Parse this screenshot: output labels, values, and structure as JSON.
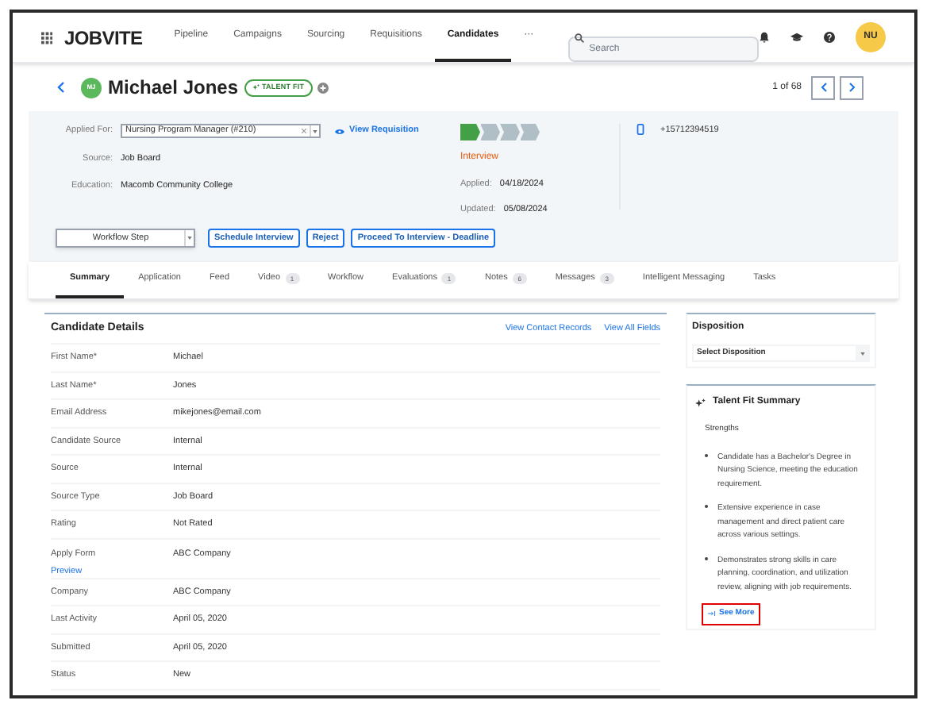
{
  "nav": {
    "logo": "JOBVITE",
    "items": [
      {
        "label": "Pipeline",
        "selected": false
      },
      {
        "label": "Campaigns",
        "selected": false
      },
      {
        "label": "Sourcing",
        "selected": false
      },
      {
        "label": "Requisitions",
        "selected": false
      },
      {
        "label": "Candidates",
        "selected": true
      },
      {
        "label": "···",
        "selected": false
      }
    ],
    "search": {
      "placeholder": "Search"
    },
    "avatar": "NU"
  },
  "header": {
    "avatar": "MJ",
    "name": "Michael Jones",
    "badge": "TALENT FIT",
    "pager": "1 of 68"
  },
  "info": {
    "fields": [
      {
        "label": "Applied For:",
        "value": "Nursing Program Manager (#210)",
        "kind": "select"
      },
      {
        "label": "Source:",
        "value": "Job Board",
        "kind": "text"
      },
      {
        "label": "Education:",
        "value": "Macomb Community College",
        "kind": "text"
      }
    ],
    "view_link": "View Requisition",
    "pipeline": [
      {
        "complete": true
      },
      {
        "complete": false
      },
      {
        "complete": false
      },
      {
        "complete": false
      }
    ],
    "stage": "Interview",
    "dates": [
      {
        "label": "Applied:",
        "value": "04/18/2024"
      },
      {
        "label": "Updated:",
        "value": "05/08/2024"
      }
    ],
    "phone": "+15712394519",
    "workflow_select": "Workflow Step",
    "buttons": [
      "Schedule Interview",
      "Reject",
      "Proceed To Interview - Deadline"
    ]
  },
  "tabs": [
    {
      "label": "Summary",
      "selected": true
    },
    {
      "label": "Application",
      "selected": false
    },
    {
      "label": "Feed",
      "selected": false
    },
    {
      "label": "Video",
      "count": "1",
      "selected": false
    },
    {
      "label": "Workflow",
      "selected": false
    },
    {
      "label": "Evaluations",
      "count": "1",
      "selected": false
    },
    {
      "label": "Notes",
      "count": "6",
      "selected": false
    },
    {
      "label": "Messages",
      "count": "3",
      "selected": false
    },
    {
      "label": "Intelligent Messaging",
      "selected": false
    },
    {
      "label": "Tasks",
      "selected": false
    }
  ],
  "details": {
    "title": "Candidate Details",
    "links": [
      "View Contact Records",
      "View All Fields"
    ],
    "rows": [
      {
        "label": "First Name*",
        "value": "Michael"
      },
      {
        "label": "Last Name*",
        "value": "Jones"
      },
      {
        "label": "Email Address",
        "value": "mikejones@email.com"
      },
      {
        "label": "Candidate Source",
        "value": "Internal"
      },
      {
        "label": "Source",
        "value": "Internal"
      },
      {
        "label": "Source Type",
        "value": "Job Board"
      },
      {
        "label": "Rating",
        "value": "Not Rated"
      },
      {
        "label": "Apply Form",
        "value": "ABC Company",
        "link": "Preview"
      },
      {
        "label": "Company",
        "value": "ABC Company"
      },
      {
        "label": "Last Activity",
        "value": "April 05, 2020"
      },
      {
        "label": "Submitted",
        "value": "April 05, 2020"
      },
      {
        "label": "Status",
        "value": "New"
      }
    ]
  },
  "disposition": {
    "title": "Disposition",
    "select": "Select Disposition"
  },
  "talent_fit": {
    "title": "Talent Fit Summary",
    "subtitle": "Strengths",
    "bullets": [
      "Candidate has a Bachelor's Degree in Nursing Science, meeting the education requirement.",
      "Extensive experience in case management and direct patient care across various settings.",
      "Demonstrates strong skills in care planning, coordination, and utilization review, aligning with job requirements."
    ],
    "see_more": {
      "label": "See More",
      "highlighted": true
    }
  }
}
